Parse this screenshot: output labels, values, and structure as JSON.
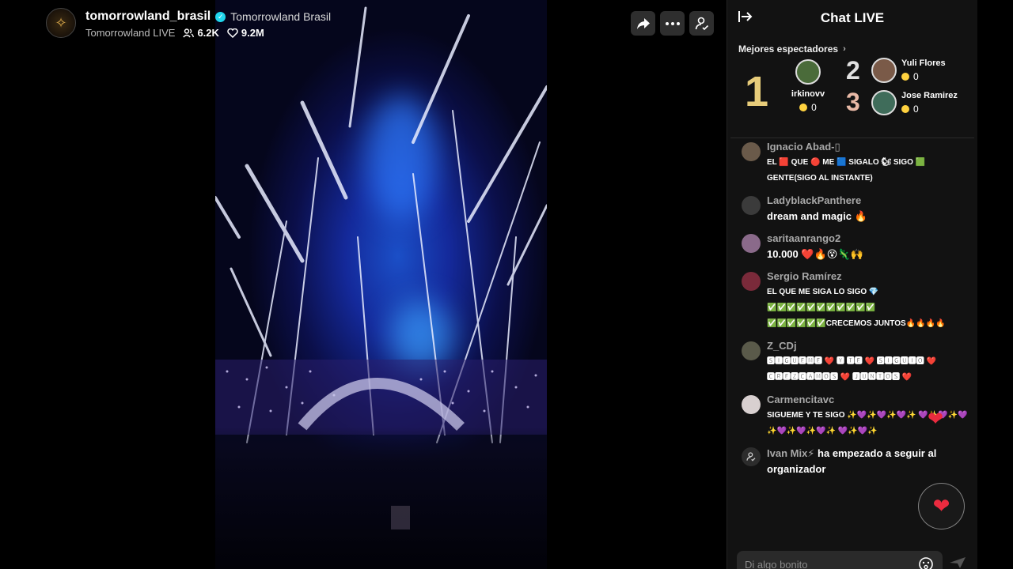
{
  "host": {
    "username": "tomorrowland_brasil",
    "display_name": "Tomorrowland Brasil",
    "live_label": "Tomorrowland LIVE",
    "viewers": "6.2K",
    "likes": "9.2M"
  },
  "icons": [
    "share-icon",
    "more-icon",
    "follow-user-icon",
    "collapse-chat-icon",
    "heart-icon",
    "emoji-icon",
    "send-icon"
  ],
  "chat": {
    "title": "Chat LIVE",
    "top_viewers_label": "Mejores espectadores",
    "top_viewers": [
      {
        "rank": "1",
        "name": "irkinovv",
        "coins": "0"
      },
      {
        "rank": "2",
        "name": "Yuli Flores",
        "coins": "0"
      },
      {
        "rank": "3",
        "name": "Jose Ramirez",
        "coins": "0"
      }
    ],
    "messages": [
      {
        "user": "Ignacio Abad-▯",
        "text": "EL 🟥 QUE 🔴 ME 🟦 SIGALO 🐿 SIGO 🟩 GENTE(SIGO AL INSTANTE)"
      },
      {
        "user": "LadyblackPanthere",
        "text": "dream and magic 🔥"
      },
      {
        "user": "saritaanrango2",
        "text": "10.000 ❤️🔥😵🦎🙌"
      },
      {
        "user": "Sergio Ramírez",
        "text": "EL QUE ME SIGA LO SIGO 💎 ✅✅✅✅✅✅✅✅✅✅✅ ✅✅✅✅✅✅CRECEMOS JUNTOS🔥🔥🔥🔥"
      },
      {
        "user": "Z_CDj",
        "text": "🆂🅸🅶🆄🅴🅼🅴 ❤️ 🆈 🆃🅴 ❤️ 🆂🅸🅶🆄🅸🅾 ❤️ 🅲🆁🅴🆉🅲🅰🅼🅾🆂 ❤️ 🅹🆄🅽🆃🅾🆂 ❤️"
      },
      {
        "user": "Carmencitavc",
        "text": "SIGUEME Y TE SIGO ✨💜✨💜✨💜✨ 💜✨💜✨💜✨💜✨💜✨💜✨ 💜✨💜✨"
      }
    ],
    "system_message": {
      "user": "Ivan Mix⚡",
      "text": " ha empezado a seguir al organizador"
    },
    "input_placeholder": "Di algo bonito"
  },
  "colors": {
    "panel_bg": "#121212",
    "accent_gold": "#e7cc7a",
    "heart_red": "#ea2b3f",
    "verified_blue": "#20d5ec"
  }
}
